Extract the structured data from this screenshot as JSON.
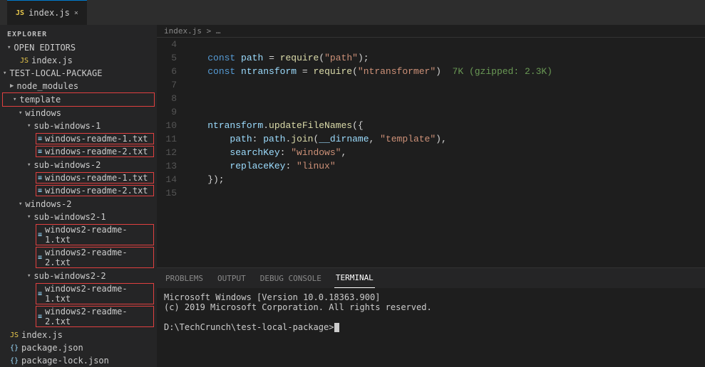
{
  "topbar": {
    "tab_label": "index.js",
    "tab_icon": "JS",
    "tab_close": "×"
  },
  "sidebar": {
    "title": "EXPLORER",
    "open_editors_label": "OPEN EDITORS",
    "open_file": "index.js",
    "project_label": "TEST-LOCAL-PACKAGE",
    "tree": [
      {
        "label": "node_modules",
        "indent": 1,
        "type": "folder",
        "collapsed": true
      },
      {
        "label": "template",
        "indent": 1,
        "type": "folder",
        "highlighted": true
      },
      {
        "label": "windows",
        "indent": 2,
        "type": "folder"
      },
      {
        "label": "sub-windows-1",
        "indent": 3,
        "type": "folder"
      },
      {
        "label": "windows-readme-1.txt",
        "indent": 4,
        "type": "txt",
        "boxed": true
      },
      {
        "label": "windows-readme-2.txt",
        "indent": 4,
        "type": "txt",
        "boxed": true
      },
      {
        "label": "sub-windows-2",
        "indent": 3,
        "type": "folder"
      },
      {
        "label": "windows-readme-1.txt",
        "indent": 4,
        "type": "txt",
        "boxed": true
      },
      {
        "label": "windows-readme-2.txt",
        "indent": 4,
        "type": "txt",
        "boxed": true
      },
      {
        "label": "windows-2",
        "indent": 2,
        "type": "folder"
      },
      {
        "label": "sub-windows2-1",
        "indent": 3,
        "type": "folder"
      },
      {
        "label": "windows2-readme-1.txt",
        "indent": 4,
        "type": "txt",
        "boxed": true
      },
      {
        "label": "windows2-readme-2.txt",
        "indent": 4,
        "type": "txt",
        "boxed": true
      },
      {
        "label": "sub-windows2-2",
        "indent": 3,
        "type": "folder"
      },
      {
        "label": "windows2-readme-1.txt",
        "indent": 4,
        "type": "txt",
        "boxed": true
      },
      {
        "label": "windows2-readme-2.txt",
        "indent": 4,
        "type": "txt",
        "boxed": true
      },
      {
        "label": "index.js",
        "indent": 1,
        "type": "js"
      },
      {
        "label": "package.json",
        "indent": 1,
        "type": "json"
      },
      {
        "label": "package-lock.json",
        "indent": 1,
        "type": "json"
      }
    ]
  },
  "breadcrumb": "index.js > …",
  "code": {
    "lines": [
      {
        "num": 4,
        "content": ""
      },
      {
        "num": 5,
        "content": "    const path = require(\"path\");"
      },
      {
        "num": 6,
        "content": "    const ntransform = require(\"ntransformer\")  7K (gzipped: 2.3K)"
      },
      {
        "num": 7,
        "content": ""
      },
      {
        "num": 8,
        "content": ""
      },
      {
        "num": 9,
        "content": ""
      },
      {
        "num": 10,
        "content": "    ntransform.updateFileNames({"
      },
      {
        "num": 11,
        "content": "        path: path.join(__dirname, \"template\"),"
      },
      {
        "num": 12,
        "content": "        searchKey: \"windows\","
      },
      {
        "num": 13,
        "content": "        replaceKey: \"linux\""
      },
      {
        "num": 14,
        "content": "    });"
      },
      {
        "num": 15,
        "content": ""
      }
    ]
  },
  "panel": {
    "tabs": [
      "PROBLEMS",
      "OUTPUT",
      "DEBUG CONSOLE",
      "TERMINAL"
    ],
    "active_tab": "TERMINAL",
    "terminal_lines": [
      "Microsoft Windows [Version 10.0.18363.900]",
      "(c) 2019 Microsoft Corporation. All rights reserved.",
      "",
      "D:\\TechCrunch\\test-local-package>"
    ]
  }
}
